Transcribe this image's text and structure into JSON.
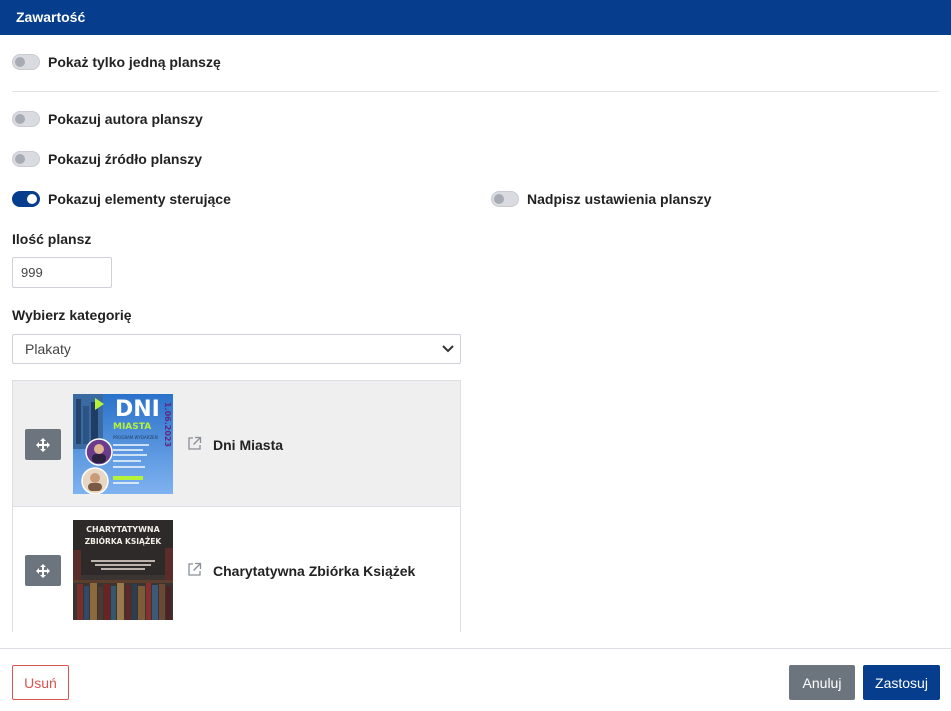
{
  "header": {
    "title": "Zawartość"
  },
  "toggles": {
    "single_board": {
      "label": "Pokaż tylko jedną planszę",
      "on": false
    },
    "show_author": {
      "label": "Pokazuj autora planszy",
      "on": false
    },
    "show_source": {
      "label": "Pokazuj źródło planszy",
      "on": false
    },
    "show_controls": {
      "label": "Pokazuj elementy sterujące",
      "on": true
    },
    "override_settings": {
      "label": "Nadpisz ustawienia planszy",
      "on": false
    }
  },
  "count": {
    "label": "Ilość plansz",
    "value": "999"
  },
  "category": {
    "label": "Wybierz kategorię",
    "selected": "Plakaty"
  },
  "items": [
    {
      "title": "Dni Miasta",
      "thumb_text": {
        "big": "DNI",
        "sub": "MIASTA",
        "date": "1.06.2023",
        "program": "PROGRAM WYDARZEŃ"
      }
    },
    {
      "title": "Charytatywna Zbiórka Książek",
      "thumb_text": {
        "line1": "CHARYTATYWNA",
        "line2": "ZBIÓRKA KSIĄŻEK"
      }
    }
  ],
  "footer": {
    "delete_label": "Usuń",
    "cancel_label": "Anuluj",
    "apply_label": "Zastosuj"
  },
  "colors": {
    "primary": "#063d8c",
    "secondary": "#6c757d",
    "danger": "#d9534f"
  }
}
